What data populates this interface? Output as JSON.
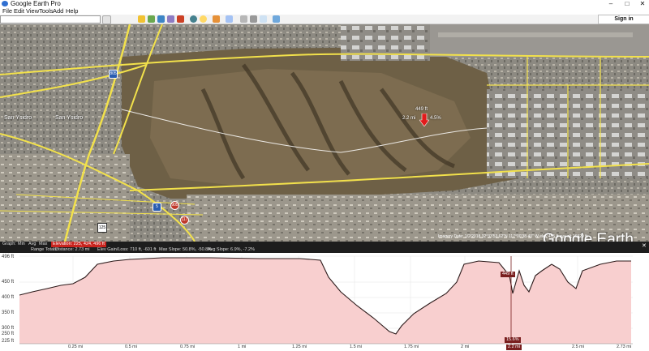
{
  "window": {
    "title": "Google Earth Pro",
    "minimize": "–",
    "maximize": "□",
    "close": "✕"
  },
  "menu": [
    "File",
    "Edit",
    "View",
    "Tools",
    "Add",
    "Help"
  ],
  "toolbar": {
    "sign_in": "Sign in"
  },
  "map": {
    "labels": {
      "san_ysidro": "San Ysidro",
      "san_ysidro2": "San Ysidro",
      "shield_805": "805",
      "shield_905": "905",
      "shield_5": "5",
      "shield_117": "117",
      "shield_125": "125",
      "point_elev": "449 ft",
      "point_dist": "2.2 mi",
      "point_slope": "4.5%"
    },
    "logo": "Google Earth",
    "status_line": "Imagery Date: 1/2/2018  32°33'53.62\"N 117°00'38.40\" W  elev  455 ft  eye alt 16629 ft"
  },
  "profile": {
    "header": {
      "graph": "Graph:",
      "min": "Min",
      "avg": "Avg",
      "max": "Max",
      "elevation": "Elevation: 225, 424, 496 ft",
      "range_totals": "Range Totals:",
      "distance": "Distance: 2.73 mi",
      "elev_gain": "Elev Gain/Loss: 710 ft, -601 ft",
      "max_slope": "Max Slope: 50.8%, -50.8%",
      "avg_slope": "Avg Slope: 6.9%, -7.2%"
    },
    "cursor_value": "449 ft",
    "cursor_slope": "15.6%",
    "cursor_dist": "2.2 mi",
    "y_ticks": [
      "496 ft",
      "450 ft",
      "400 ft",
      "350 ft",
      "300 ft",
      "250 ft",
      "225 ft"
    ],
    "x_ticks": [
      "0.25 mi",
      "0.5 mi",
      "0.75 mi",
      "1 mi",
      "1.25 mi",
      "1.5 mi",
      "1.75 mi",
      "2 mi",
      "2.5 mi",
      "2.73 mi"
    ]
  },
  "colors": {
    "profile_fill": "#f8cfcf",
    "profile_line": "#2b1a1a",
    "road": "#f2e14b",
    "placemark": "#e21b1b"
  },
  "icons": {
    "placemark": "placemark-icon"
  }
}
